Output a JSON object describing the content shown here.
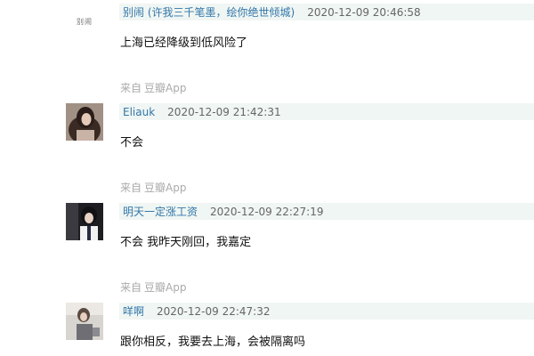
{
  "comments": [
    {
      "avatar_text": "别闹",
      "author": "别闹",
      "signature": "(许我三千笔墨，绘你绝世倾城)",
      "time": "2020-12-09 20:46:58",
      "content": "上海已经降级到低风险了",
      "source_prefix": "来自",
      "source_app": "豆瓣App"
    },
    {
      "author": "Eliauk",
      "time": "2020-12-09 21:42:31",
      "content": "不会",
      "source_prefix": "来自",
      "source_app": "豆瓣App"
    },
    {
      "author": "明天一定涨工资",
      "time": "2020-12-09 22:27:19",
      "content": "不会 我昨天刚回，我嘉定",
      "source_prefix": "来自",
      "source_app": "豆瓣App"
    },
    {
      "author": "咩啊",
      "time": "2020-12-09 22:47:32",
      "content": "跟你相反，我要去上海，会被隔离吗"
    }
  ],
  "colors": {
    "author_link": "#3377aa",
    "header_bg": "#f0f6f3",
    "source_gray": "#aaaaaa"
  }
}
